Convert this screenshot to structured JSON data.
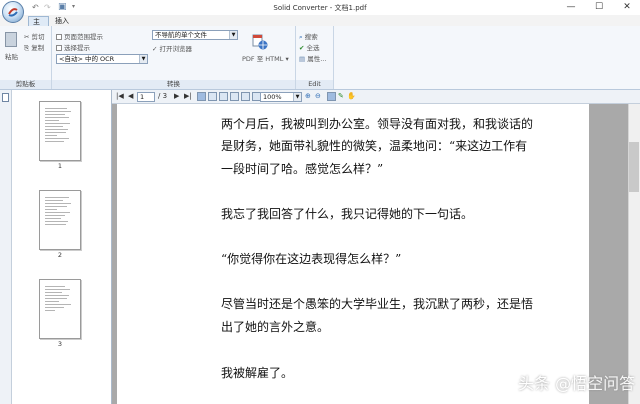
{
  "titlebar": {
    "title": "Solid Converter - 文档1.pdf",
    "qat": {
      "undo": "↶",
      "redo": "↷",
      "save": "▣"
    },
    "controls": {
      "minimize": "—",
      "maximize": "☐",
      "close": "✕"
    }
  },
  "tabs": [
    {
      "label": "主页"
    },
    {
      "label": "插入"
    }
  ],
  "ribbon": {
    "clipboard": {
      "paste": "粘贴",
      "cut": "剪切",
      "copy": "复制",
      "group_label": "剪贴板"
    },
    "convert": {
      "page_range": "页面范围提示",
      "selection": "选择提示",
      "ocr_select": "<自动> 中的 OCR",
      "mode_select": "不导航的单个文件",
      "open_browser": "✓ 打开浏览器",
      "pdf_to_html": "PDF 至 HTML",
      "group_label": "转换"
    },
    "edit": {
      "search": "搜索",
      "select_all": "全选",
      "properties": "属性...",
      "group_label": "Edit"
    }
  },
  "toolbar": {
    "page": "1",
    "page_total": "/ 3",
    "zoom": "100%"
  },
  "thumbnails": [
    {
      "label": "1"
    },
    {
      "label": "2"
    },
    {
      "label": "3"
    }
  ],
  "document": {
    "lines": [
      "两个月后，我被叫到办公室。领导没有面对我，和我谈话的",
      "是财务，她面带礼貌性的微笑，温柔地问：“来这边工作有",
      "一段时间了哈。感觉怎么样？”",
      "我忘了我回答了什么，我只记得她的下一句话。",
      "“你觉得你在这边表现得怎么样？”",
      "尽管当时还是个愚笨的大学毕业生，我沉默了两秒，还是悟",
      "出了她的言外之意。",
      "我被解雇了。"
    ]
  },
  "watermark": "头条 @悟空问答"
}
